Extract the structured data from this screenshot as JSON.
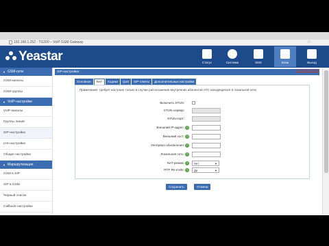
{
  "browser": {
    "url": "192.168.1.252 · TG200 – VoIP GSM Gateway"
  },
  "header": {
    "logo_text": "Yeastar",
    "buttons": [
      {
        "label": "Статус",
        "icon": "chart-icon"
      },
      {
        "label": "Система",
        "icon": "gear-icon"
      },
      {
        "label": "SMS",
        "icon": "sms-icon"
      },
      {
        "label": "Блок",
        "icon": "device-icon"
      },
      {
        "label": "Выход",
        "icon": "logout-icon"
      }
    ],
    "active_button": "Блок"
  },
  "sidebar": {
    "sections": [
      {
        "title": "GSM-сети",
        "items": [
          "GSM-каналы",
          "GSM-группы"
        ]
      },
      {
        "title": "VoIP-настройки",
        "items": [
          "VoIP-каналы",
          "Группы линий",
          "SIP-настройки",
          "IAX-настройки",
          "Общие настройки"
        ]
      },
      {
        "title": "Маршрутизация",
        "items": [
          "GSM в SIP",
          "SIP в GSM",
          "Черный список",
          "Callback-настройки"
        ]
      }
    ],
    "active_item": "SIP-настройки"
  },
  "main": {
    "title": "SIP-настройки",
    "help_link": "Русский вопрос",
    "tabs": [
      "Основное",
      "NAT",
      "Кодеки",
      "QoS",
      "SIP-ответы",
      "Дополнительные настройки"
    ],
    "active_tab": "NAT",
    "notice": "Примечание: требует настроил только в случае расположения внутренних абонентов АТС находящегося в локальной сети",
    "fields": {
      "enable_stun": {
        "label": "Включить STUN:"
      },
      "stun_server": {
        "label": "STUN-сервер:",
        "value": ""
      },
      "stun_port": {
        "label": "STUN-порт:",
        "value": ""
      },
      "external_ip": {
        "label": "Внешний IP-адрес:",
        "value": ""
      },
      "external_host": {
        "label": "Внешний хост:",
        "value": ""
      },
      "update_interval": {
        "label": "Интервал обновления:",
        "value": ""
      },
      "local_network": {
        "label": "Локальная сеть:",
        "value": ""
      },
      "nat_mode": {
        "label": "NAT-режим:",
        "value": "Нет"
      },
      "rtp_reinvite": {
        "label": "RTP Re-invite:",
        "value": "Да"
      }
    },
    "buttons": {
      "save": "Сохранить",
      "cancel": "Отмена"
    }
  }
}
